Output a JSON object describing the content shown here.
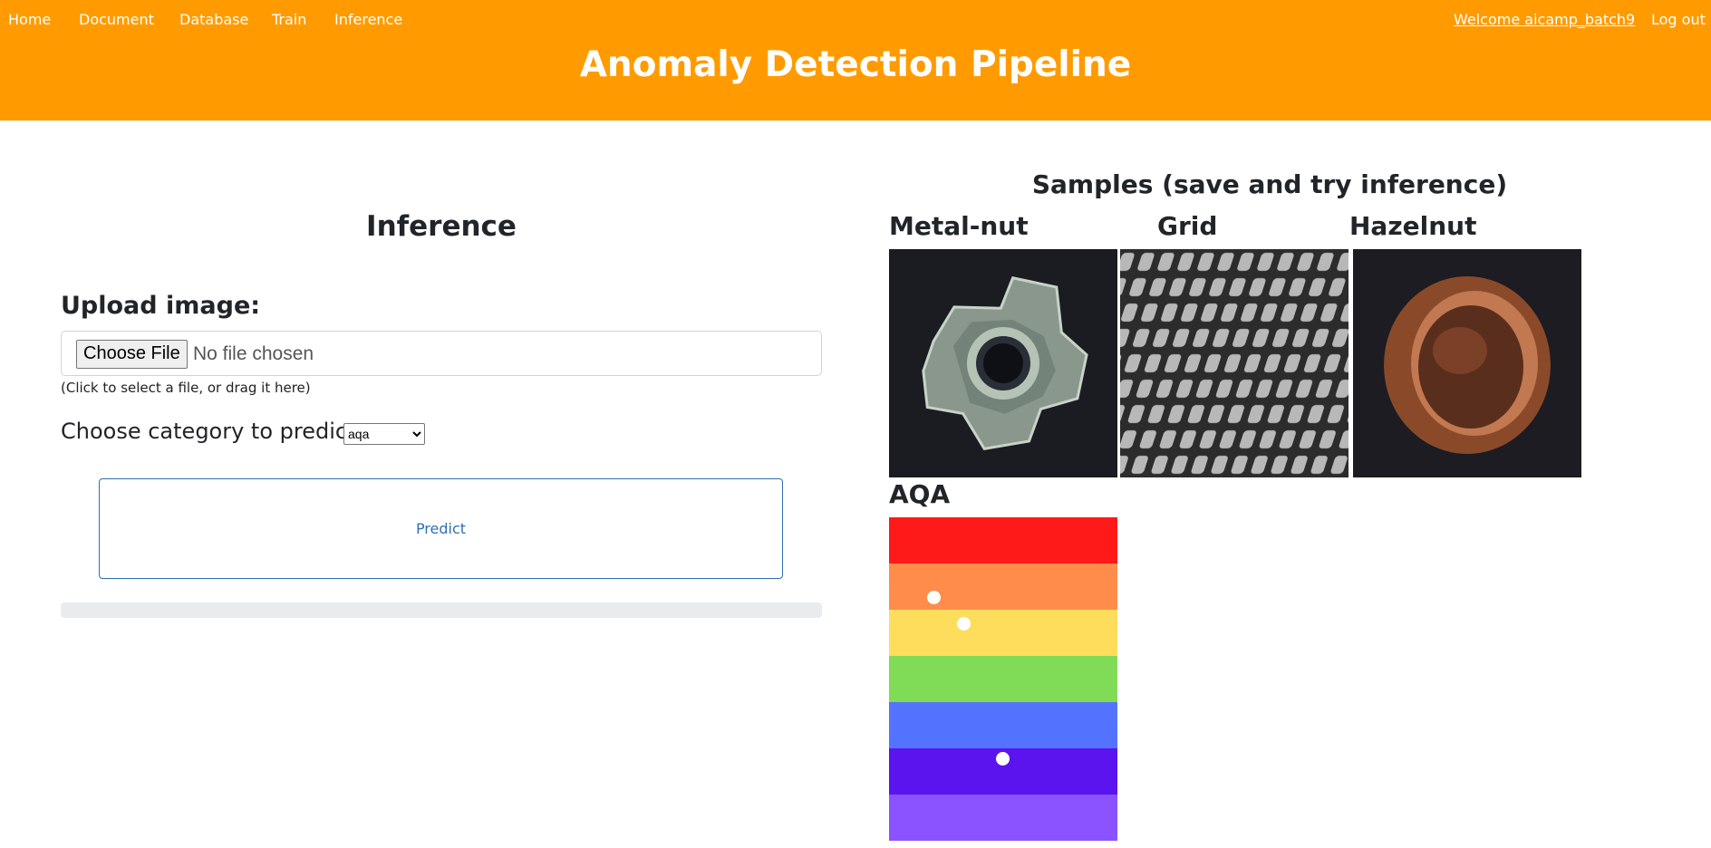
{
  "nav": {
    "left": [
      "Home",
      "Document",
      "Database",
      "Train",
      "Inference"
    ],
    "welcome": "Welcome aicamp_batch9",
    "logout": "Log out"
  },
  "header": {
    "title": "Anomaly Detection Pipeline",
    "bg": "#ff9b00"
  },
  "inference": {
    "heading": "Inference",
    "upload_label": "Upload image:",
    "choose_file": "Choose File",
    "no_file": "No file chosen",
    "hint": "(Click to select a file, or drag it here)",
    "category_label": "Choose category to predict:",
    "category_selected": "aqa",
    "predict": "Predict"
  },
  "samples": {
    "heading": "Samples (save and try inference)",
    "items": [
      {
        "label": "Metal-nut",
        "icon": "metal-nut-image"
      },
      {
        "label": "Grid",
        "icon": "grid-mesh-image"
      },
      {
        "label": "Hazelnut",
        "icon": "hazelnut-image"
      },
      {
        "label": "AQA",
        "icon": "aqa-stripes-image"
      }
    ],
    "aqa_stripes": [
      "#ff1a1a",
      "#ff8c4a",
      "#ffdd5c",
      "#80db56",
      "#5373ff",
      "#5b14ee",
      "#8b52ff"
    ]
  }
}
